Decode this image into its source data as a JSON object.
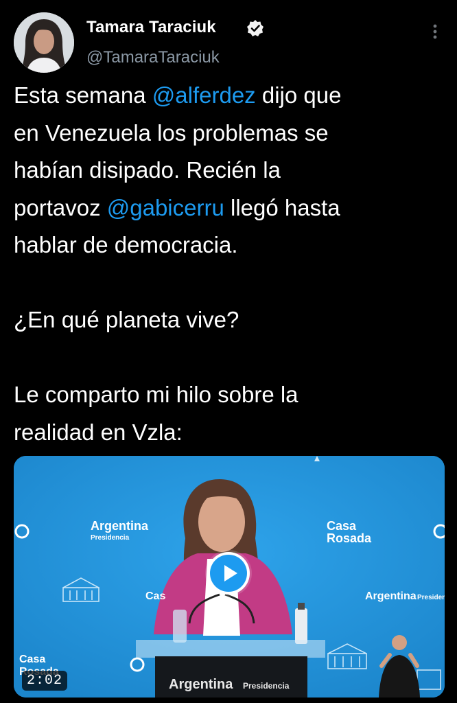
{
  "author": {
    "name": "Tamara Taraciuk",
    "handle": "@TamaraTaraciuk",
    "avatar_icon": "profile-photo",
    "verified_icon": "verified-badge-icon"
  },
  "tweet": {
    "line1_pre": "Esta semana ",
    "mention1": "@alferdez",
    "line1_post": " dijo que",
    "line2": "en Venezuela los problemas se",
    "line3": "habían disipado. Recién la",
    "line4_pre": "portavoz ",
    "mention2": "@gabicerru",
    "line4_post": " llegó hasta",
    "line5": "hablar de democracia.",
    "line6": "¿En qué planeta vive?",
    "line7": "Le comparto mi hilo sobre la",
    "line8": "realidad en Vzla:"
  },
  "media": {
    "duration": "2:02",
    "backdrop_labels": {
      "argentina_left": "Argentina",
      "presidencia_left": "Presidencia",
      "casa_right_1": "Casa",
      "rosada_right_1": "Rosada",
      "casa_mid": "Casa",
      "argentina_right": "Argentina",
      "presidencia_right": "Presiden",
      "casa_bottom_1": "Casa",
      "rosada_bottom_1": "Rosada",
      "podium_argentina": "Argentina",
      "podium_presidencia": "Presidencia"
    }
  },
  "colors": {
    "background": "#000000",
    "text": "#ffffff",
    "secondary_text": "#8b98a5",
    "mention": "#1d9bf0",
    "media_blue": "#1f8fd6"
  }
}
